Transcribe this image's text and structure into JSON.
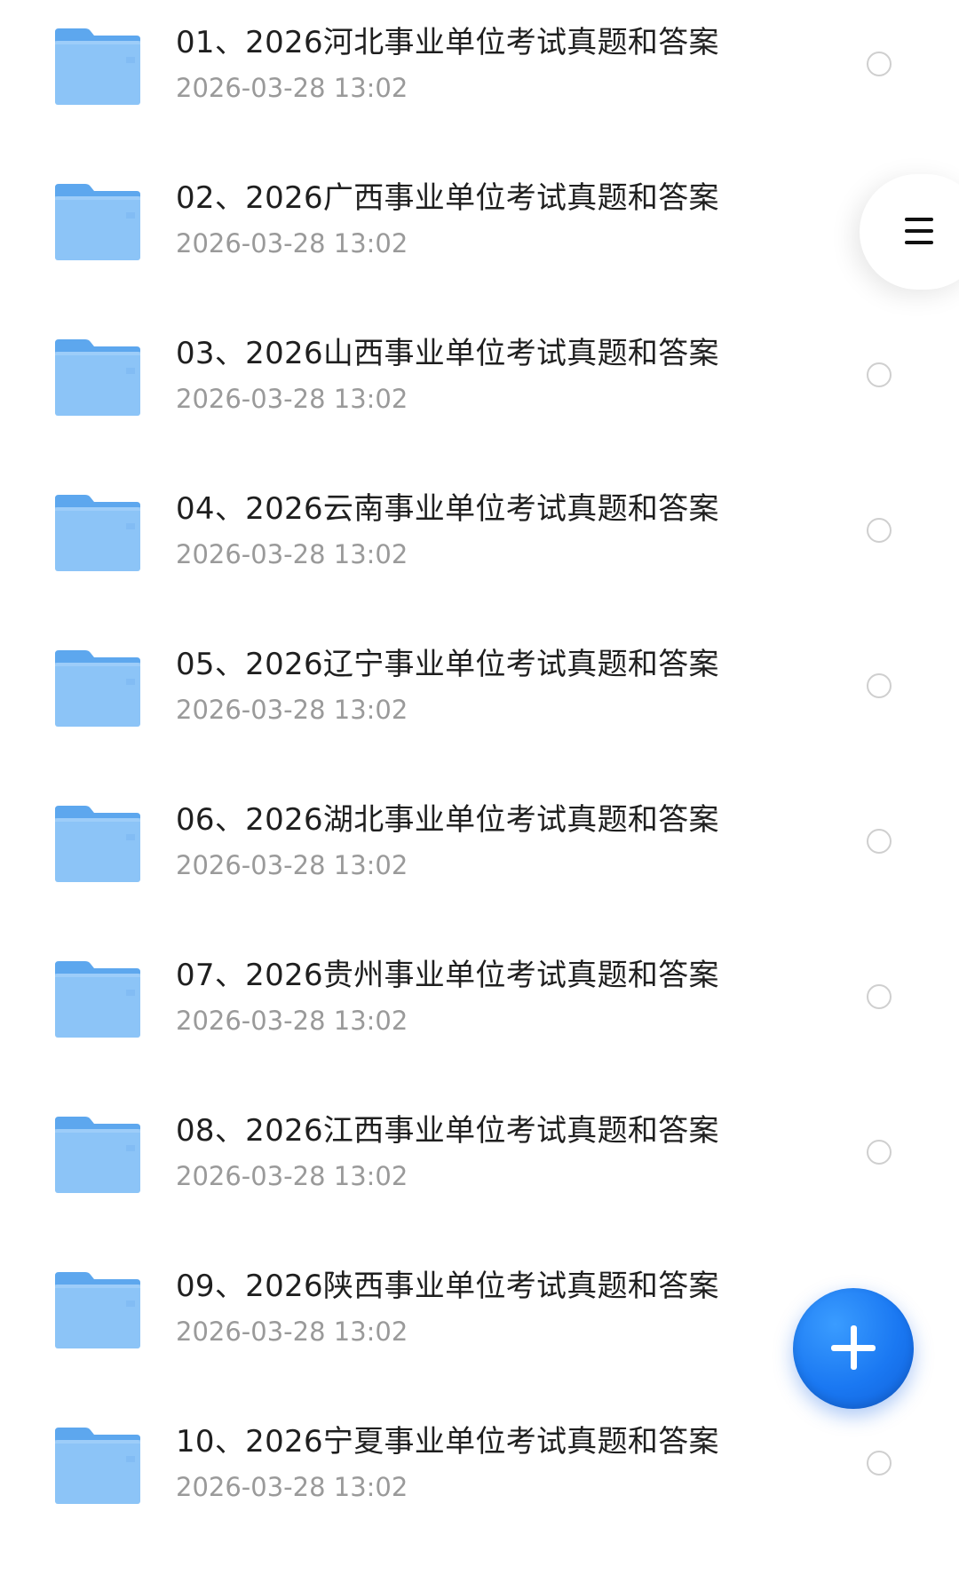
{
  "folders": [
    {
      "name": "01、2026河北事业单位考试真题和答案",
      "date": "2026-03-28 13:02"
    },
    {
      "name": "02、2026广西事业单位考试真题和答案",
      "date": "2026-03-28 13:02"
    },
    {
      "name": "03、2026山西事业单位考试真题和答案",
      "date": "2026-03-28 13:02"
    },
    {
      "name": "04、2026云南事业单位考试真题和答案",
      "date": "2026-03-28 13:02"
    },
    {
      "name": "05、2026辽宁事业单位考试真题和答案",
      "date": "2026-03-28 13:02"
    },
    {
      "name": "06、2026湖北事业单位考试真题和答案",
      "date": "2026-03-28 13:02"
    },
    {
      "name": "07、2026贵州事业单位考试真题和答案",
      "date": "2026-03-28 13:02"
    },
    {
      "name": "08、2026江西事业单位考试真题和答案",
      "date": "2026-03-28 13:02"
    },
    {
      "name": "09、2026陕西事业单位考试真题和答案",
      "date": "2026-03-28 13:02"
    },
    {
      "name": "10、2026宁夏事业单位考试真题和答案",
      "date": "2026-03-28 13:02"
    }
  ],
  "icons": {
    "folder": "folder-icon",
    "select": "radio-circle",
    "menu": "hamburger-menu-icon",
    "add": "plus-icon"
  },
  "colors": {
    "folder_front": "#8cc4f7",
    "folder_back": "#5da7ee",
    "fab": "#1a78f2",
    "title_text": "#1f1f1f",
    "date_text": "#9a9a9a",
    "radio_border": "#cfcfcf"
  }
}
